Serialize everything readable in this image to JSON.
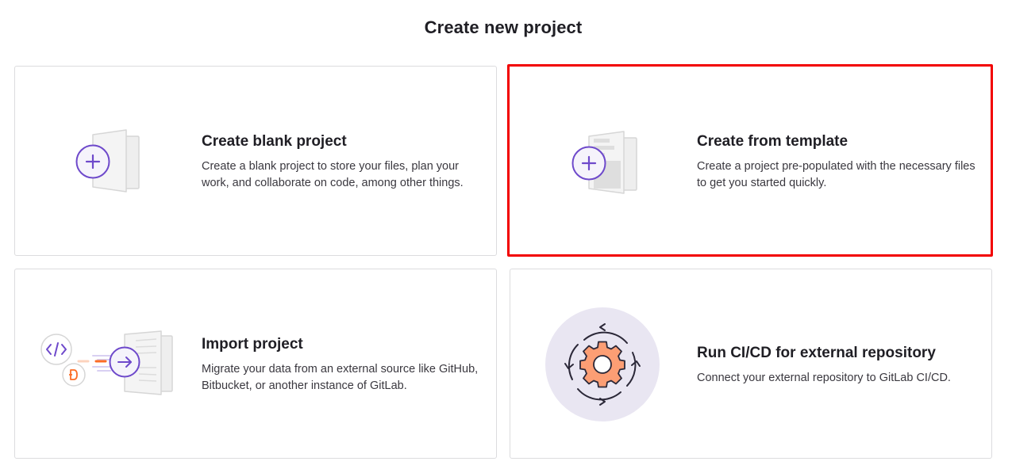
{
  "page": {
    "title": "Create new project"
  },
  "cards": [
    {
      "title": "Create blank project",
      "description": "Create a blank project to store your files, plan your work, and collaborate on code, among other things.",
      "icon": "blank-project-icon"
    },
    {
      "title": "Create from template",
      "description": "Create a project pre-populated with the necessary files to get you started quickly.",
      "icon": "template-project-icon"
    },
    {
      "title": "Import project",
      "description": "Migrate your data from an external source like GitHub, Bitbucket, or another instance of GitLab.",
      "icon": "import-project-icon"
    },
    {
      "title": "Run CI/CD for external repository",
      "description": "Connect your external repository to GitLab CI/CD.",
      "icon": "cicd-external-repo-icon"
    }
  ],
  "colors": {
    "accent_purple": "#6e49cb",
    "purple_fill": "#f5f3fb",
    "highlight_red": "#f20000",
    "orange": "#fc6d26",
    "circle_bg": "#e9e6f2"
  }
}
